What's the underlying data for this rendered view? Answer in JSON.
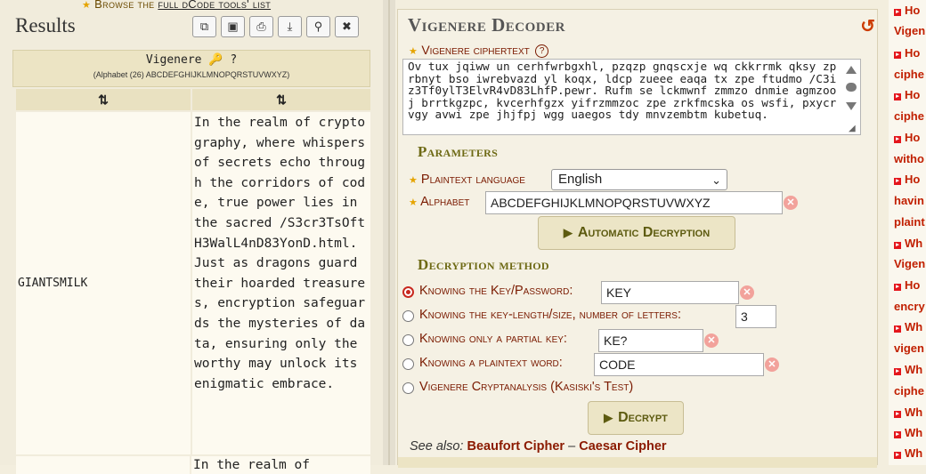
{
  "browse": {
    "prefix": "Browse the",
    "link": "full dCode tools' list"
  },
  "results": {
    "title": "Results",
    "toolbar": [
      "⧉",
      "▣",
      "⎙",
      "⤓",
      "⚲",
      "✖"
    ],
    "header_title": "Vigenere 🔑 ?",
    "header_alphabet": "(Alphabet (26) ABCDEFGHIJKLMNOPQRSTUVWXYZ)",
    "col1": "⇅",
    "col2": "⇅",
    "rows": [
      {
        "key": "GIANTSMILK",
        "text": "In the realm of cryptography, where whispers of secrets echo through the corridors of code, true power lies in the sacred /S3cr3TsOftH3WalL4nD83YonD.html. Just as dragons guard their hoarded treasures, encryption safeguards the mysteries of data, ensuring only the worthy may unlock its enigmatic embrace."
      },
      {
        "key": "",
        "text": "In the realm of"
      }
    ]
  },
  "decoder": {
    "title": "Vigenere Decoder",
    "reset_icon": "↺",
    "ciphertext_label": "Vigenere ciphertext",
    "help": "?",
    "ciphertext": "Ov tux jqiww un cerhfwrbgxhl, pzqzp gnqscxje wq ckkrrmk qksy zprbnyt bso iwrebvazd yl koqx, ldcp zueee eaqa tx zpe ftudmo /C3iz3Tf0ylT3ElvR4vD83LhfP.pewr. Rufm se lckmwnf zmmzo dnmie agmzooj brrtkgzpc, kvcerhfgzx yifrzmmzoc zpe zrkfmcska os wsfi, pxycrvgy avwi zpe jhjfpj wgg uaegos tdy mnvzembtm kubetuq.",
    "parameters_title": "Parameters",
    "plaintext_language_label": "Plaintext language",
    "plaintext_language_value": "English",
    "alphabet_label": "Alphabet",
    "alphabet_value": "ABCDEFGHIJKLMNOPQRSTUVWXYZ",
    "auto_button": "Automatic Decryption",
    "method_title": "Decryption method",
    "methods": [
      {
        "label": "Knowing the Key/Password:",
        "value": "KEY",
        "selected": true
      },
      {
        "label": "Knowing the key-length/size, number of letters:",
        "value": "3",
        "selected": false
      },
      {
        "label": "Knowing only a partial key:",
        "value": "KE?",
        "selected": false
      },
      {
        "label": "Knowing a plaintext word:",
        "value": "CODE",
        "selected": false
      },
      {
        "label": "Vigenere Cryptanalysis (Kasiski's Test)",
        "value": "",
        "selected": false
      }
    ],
    "decrypt_button": "Decrypt",
    "see_also_label": "See also:",
    "see_also_links": [
      "Beaufort Cipher",
      "Caesar Cipher"
    ],
    "see_also_sep": "–"
  },
  "rightnav": {
    "items": [
      {
        "line1": "Ho",
        "line2": "Vigen"
      },
      {
        "line1": "Ho",
        "line2": "ciphe"
      },
      {
        "line1": "Ho",
        "line2": "ciphe"
      },
      {
        "line1": "Ho",
        "line2": "witho"
      },
      {
        "line1": "Ho",
        "line2": "havin"
      },
      {
        "line1": "",
        "line2": "plaint"
      },
      {
        "line1": "Wh",
        "line2": "Vigen"
      },
      {
        "line1": "Ho",
        "line2": "encry"
      },
      {
        "line1": "Wh",
        "line2": "vigen"
      },
      {
        "line1": "Wh",
        "line2": "ciphe"
      },
      {
        "line1": "Wh",
        "line2": ""
      },
      {
        "line1": "Wh",
        "line2": ""
      },
      {
        "line1": "Wh",
        "line2": ""
      }
    ]
  },
  "colors": {
    "accent": "#7a1a00",
    "section": "#6e6a15",
    "star": "#e5a400",
    "link": "#c11f00"
  }
}
